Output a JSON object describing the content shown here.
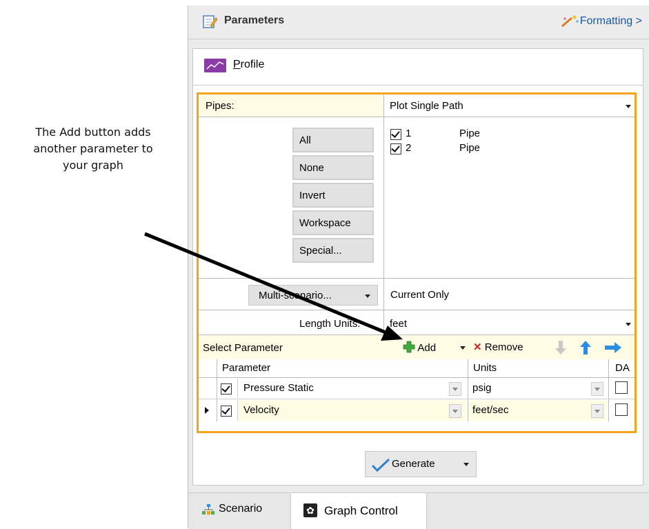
{
  "callout": {
    "line1": "The Add button adds",
    "line2": "another parameter to",
    "line3": "your graph"
  },
  "header": {
    "title": "Parameters",
    "formatting_label": "Formatting >"
  },
  "profile_tab": {
    "label": "Profile",
    "icon": "profile-line-chart-icon",
    "icon_color": "#8b3aa7"
  },
  "pipes": {
    "label": "Pipes:",
    "mode_value": "Plot Single Path",
    "buttons": [
      "All",
      "None",
      "Invert",
      "Workspace",
      "Special..."
    ],
    "items": [
      {
        "id": "1",
        "type": "Pipe",
        "checked": true
      },
      {
        "id": "2",
        "type": "Pipe",
        "checked": true
      }
    ]
  },
  "scenario": {
    "button_label": "Multi-scenario...",
    "value": "Current Only"
  },
  "length_units": {
    "label": "Length Units:",
    "value": "feet"
  },
  "select_parameter": {
    "label": "Select Parameter",
    "add_label": "Add",
    "remove_label": "Remove"
  },
  "param_table": {
    "headers": {
      "parameter": "Parameter",
      "units": "Units",
      "da": "DA"
    },
    "rows": [
      {
        "checked": true,
        "parameter": "Pressure Static",
        "units": "psig",
        "da": false,
        "current": false
      },
      {
        "checked": true,
        "parameter": "Velocity",
        "units": "feet/sec",
        "da": false,
        "current": true
      }
    ]
  },
  "generate_label": "Generate",
  "bottom_tabs": {
    "scenario": "Scenario",
    "graph_control": "Graph Control"
  },
  "colors": {
    "highlight_orange": "#f6a21b",
    "row_yellow": "#fefde3",
    "header_yellow": "#fdfbe4",
    "accent_blue": "#1a5aa8"
  }
}
